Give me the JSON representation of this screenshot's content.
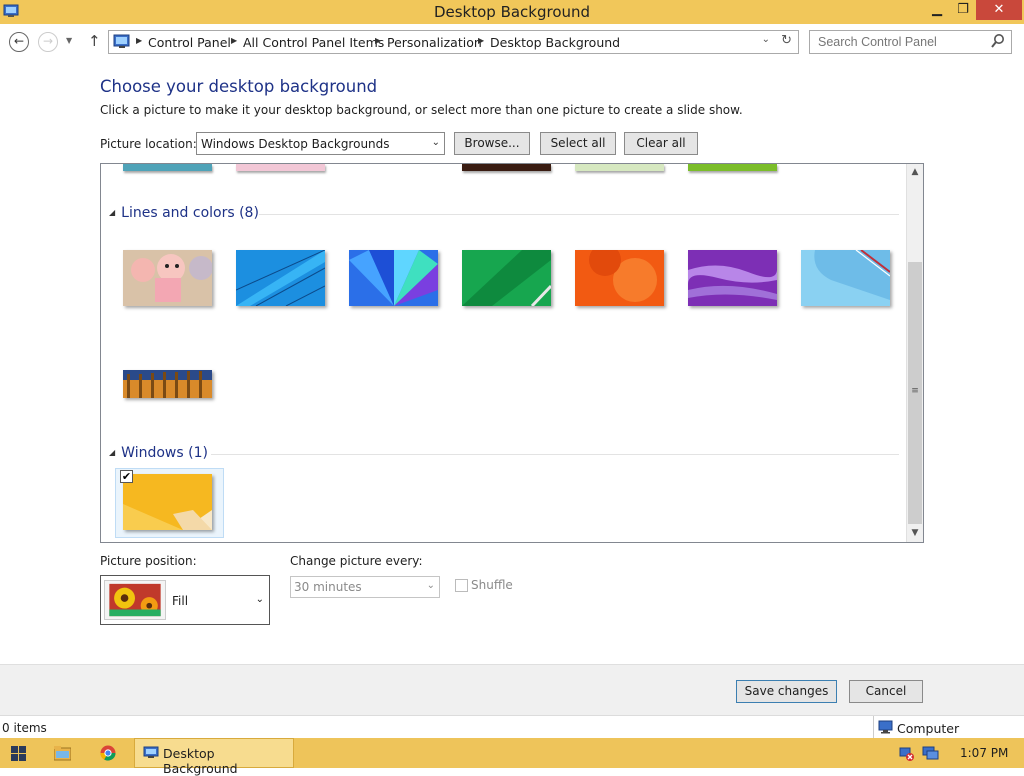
{
  "window": {
    "title": "Desktop Background",
    "minimize": "▁",
    "maximize": "❐",
    "close": "✕"
  },
  "nav": {
    "back": "←",
    "forward": "→",
    "history": "▼",
    "up": "↑",
    "breadcrumbs": [
      "Control Panel",
      "All Control Panel Items",
      "Personalization",
      "Desktop Background"
    ],
    "address_dropdown": "⌄",
    "refresh": "↻",
    "search_placeholder": "Search Control Panel"
  },
  "main": {
    "heading": "Choose your desktop background",
    "description": "Click a picture to make it your desktop background, or select more than one picture to create a slide show.",
    "picture_location_label": "Picture location:",
    "picture_location_value": "Windows Desktop Backgrounds",
    "browse_label": "Browse...",
    "select_all_label": "Select all",
    "clear_all_label": "Clear all"
  },
  "gallery": {
    "groups": [
      {
        "label": "Lines and colors (8)",
        "collapse_glyph": "◢",
        "selected_count": 0
      },
      {
        "label": "Windows (1)",
        "collapse_glyph": "◢",
        "selected_count": 1
      }
    ],
    "check_mark": "✔",
    "scroll_up": "▲",
    "scroll_down": "▼",
    "scroll_grip": "≡",
    "thumb_colors": {
      "cartoon": "#d9c2a8",
      "blue_lines": "#1c8fe0",
      "blue_fan": "#2b6fe8",
      "green": "#17a64f",
      "orange": "#f25a12",
      "purple": "#7d2fb5",
      "light_blue": "#8ad1f2",
      "fence": "#d98a2a",
      "windows_yellow": "#f6b820"
    }
  },
  "options": {
    "picture_position_label": "Picture position:",
    "picture_position_value": "Fill",
    "change_every_label": "Change picture every:",
    "change_every_value": "30 minutes",
    "shuffle_label": "Shuffle",
    "shuffle_checked": false
  },
  "footer": {
    "save_label": "Save changes",
    "cancel_label": "Cancel"
  },
  "status": {
    "items": "0 items",
    "computer": "Computer"
  },
  "taskbar": {
    "task_label": "Desktop Background",
    "clock": "1:07 PM",
    "accent": "#eec45a"
  }
}
